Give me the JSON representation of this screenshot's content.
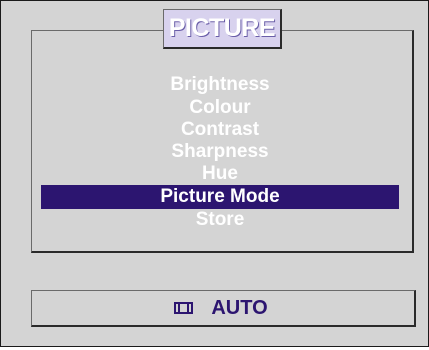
{
  "osd": {
    "title": "PICTURE",
    "menu_items": [
      {
        "label": "Brightness",
        "selected": false
      },
      {
        "label": "Colour",
        "selected": false
      },
      {
        "label": "Contrast",
        "selected": false
      },
      {
        "label": "Sharpness",
        "selected": false
      },
      {
        "label": "Hue",
        "selected": false
      },
      {
        "label": "Picture Mode",
        "selected": true
      },
      {
        "label": "Store",
        "selected": false
      }
    ],
    "status": {
      "icon": "screen-mode-icon",
      "label": "AUTO"
    }
  },
  "colors": {
    "background": "#d4d4d4",
    "title_tab": "#d8d2ee",
    "menu_text": "#ffffff",
    "highlight": "#2c1570",
    "status_text": "#2c1570"
  }
}
